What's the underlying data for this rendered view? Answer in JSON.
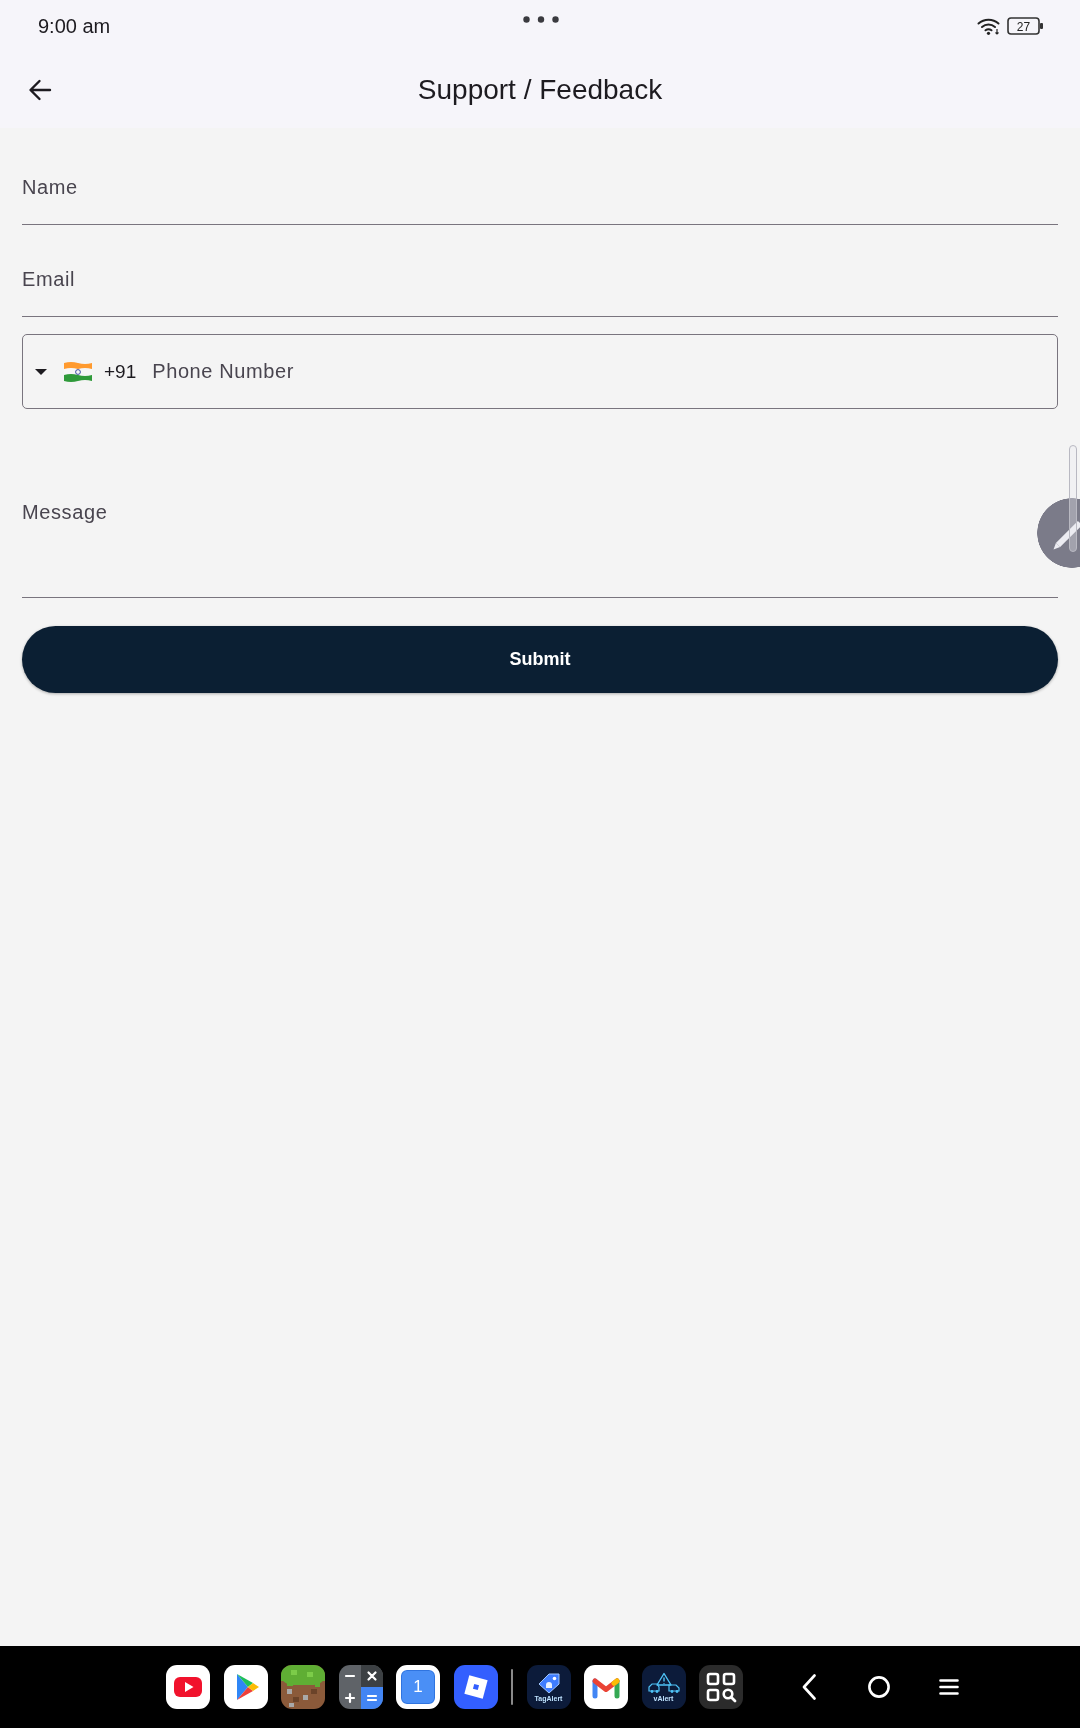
{
  "status_bar": {
    "time": "9:00 am",
    "battery": "27"
  },
  "app_bar": {
    "title": "Support / Feedback"
  },
  "form": {
    "fields": [
      {
        "kind": "text",
        "placeholder": "Name"
      },
      {
        "kind": "text",
        "placeholder": "Email"
      },
      {
        "kind": "phone",
        "country_code": "+91",
        "placeholder": "Phone Number"
      },
      {
        "kind": "multiline",
        "placeholder": "Message"
      }
    ],
    "submit": "Submit"
  },
  "taskbar": {
    "apps": [
      {
        "kind": "play"
      },
      {
        "kind": "store"
      },
      {
        "kind": "blocks"
      },
      {
        "kind": "calculator"
      },
      {
        "kind": "number",
        "label": "1"
      },
      {
        "kind": "square"
      },
      {
        "kind": "separator"
      },
      {
        "kind": "tag",
        "label": "TagAlert"
      },
      {
        "kind": "mail"
      },
      {
        "kind": "alert",
        "label": "vAlert"
      },
      {
        "kind": "scanner"
      }
    ]
  }
}
